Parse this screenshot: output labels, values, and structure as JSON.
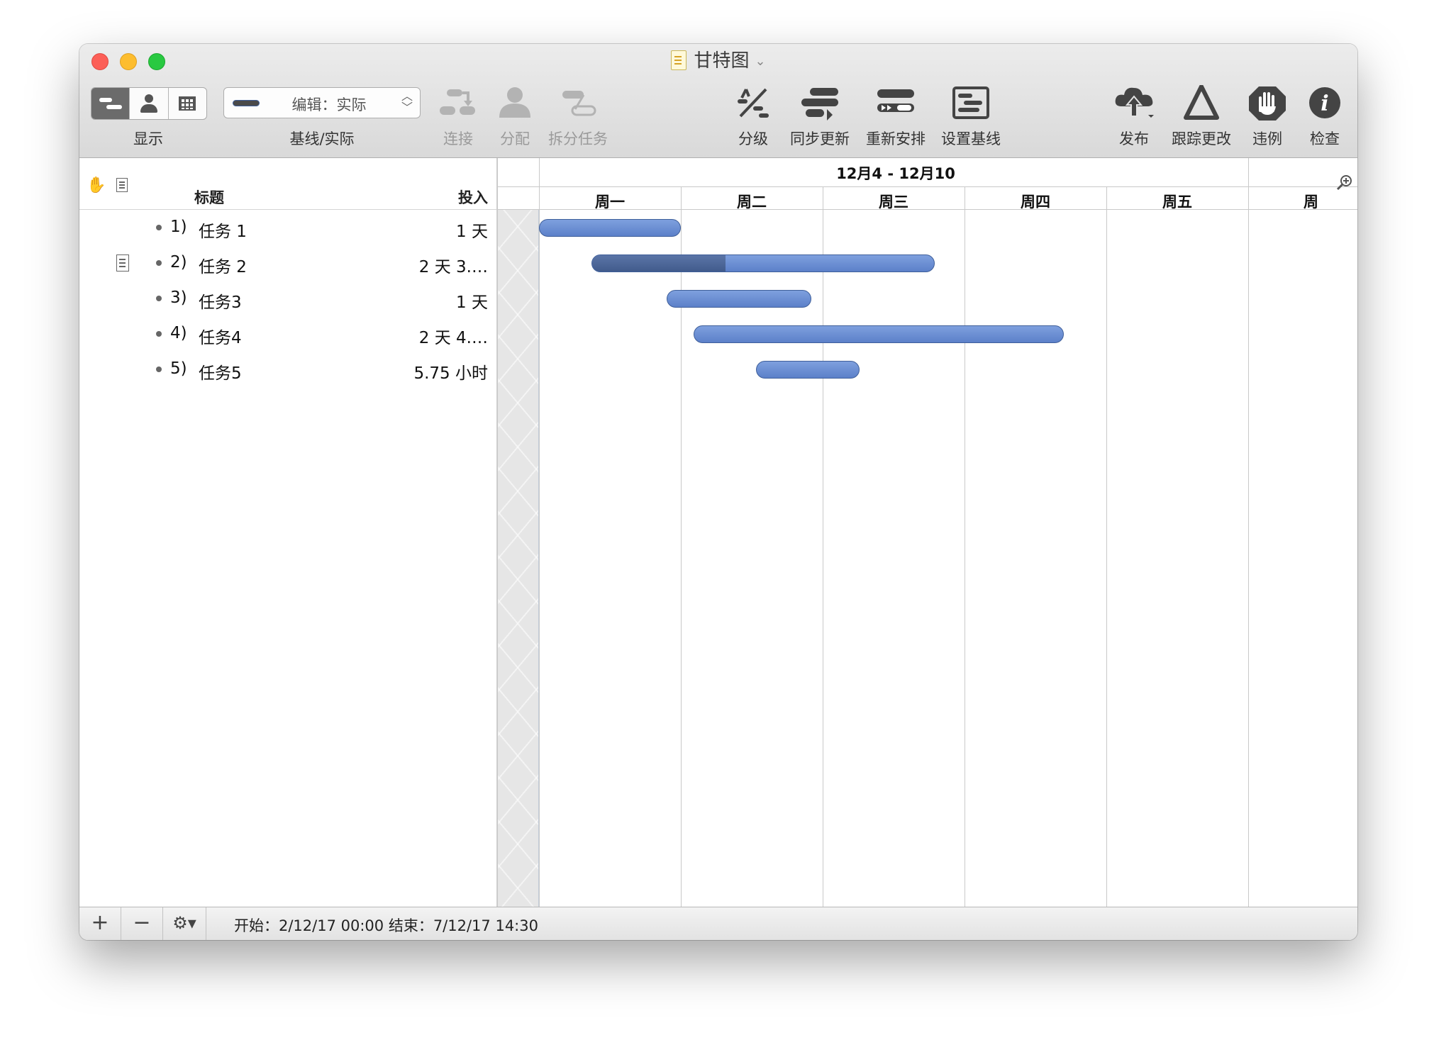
{
  "window": {
    "title": "甘特图"
  },
  "toolbar": {
    "display_label": "显示",
    "baseline_popup_value": "编辑：实际",
    "baseline_label": "基线/实际",
    "connect_label": "连接",
    "assign_label": "分配",
    "split_label": "拆分任务",
    "level_label": "分级",
    "catch_up_label": "同步更新",
    "reschedule_label": "重新安排",
    "set_baseline_label": "设置基线",
    "publish_label": "发布",
    "track_changes_label": "跟踪更改",
    "violations_label": "违例",
    "inspect_label": "检查"
  },
  "outline": {
    "col_title": "标题",
    "col_effort": "投入",
    "tasks": [
      {
        "num": "1)",
        "name": "任务 1",
        "effort": "1 天",
        "has_note": false
      },
      {
        "num": "2)",
        "name": "任务 2",
        "effort": "2 天 3.…",
        "has_note": true
      },
      {
        "num": "3)",
        "name": "任务3",
        "effort": "1 天",
        "has_note": false
      },
      {
        "num": "4)",
        "name": "任务4",
        "effort": "2 天 4.…",
        "has_note": false
      },
      {
        "num": "5)",
        "name": "任务5",
        "effort": "5.75 小时",
        "has_note": false
      }
    ]
  },
  "gantt": {
    "week_label": "12月4 - 12月10",
    "days": [
      "周一",
      "周二",
      "周三",
      "周四",
      "周五",
      "周"
    ],
    "bars": [
      {
        "task": "任务 1",
        "start_day": 0.0,
        "duration_days": 1.0,
        "complete": 0
      },
      {
        "task": "任务 2",
        "start_day": 0.37,
        "duration_days": 2.42,
        "complete": 0.39
      },
      {
        "task": "任务3",
        "start_day": 0.9,
        "duration_days": 1.02,
        "complete": 0
      },
      {
        "task": "任务4",
        "start_day": 1.09,
        "duration_days": 2.61,
        "complete": 0
      },
      {
        "task": "任务5",
        "start_day": 1.53,
        "duration_days": 0.73,
        "complete": 0
      }
    ],
    "bar_color": "#6b8fd6",
    "bar_complete_color": "#4a6496"
  },
  "status_bar": {
    "add": "+",
    "remove": "−",
    "text": "开始：2/12/17 00:00 结束：7/12/17 14:30"
  }
}
